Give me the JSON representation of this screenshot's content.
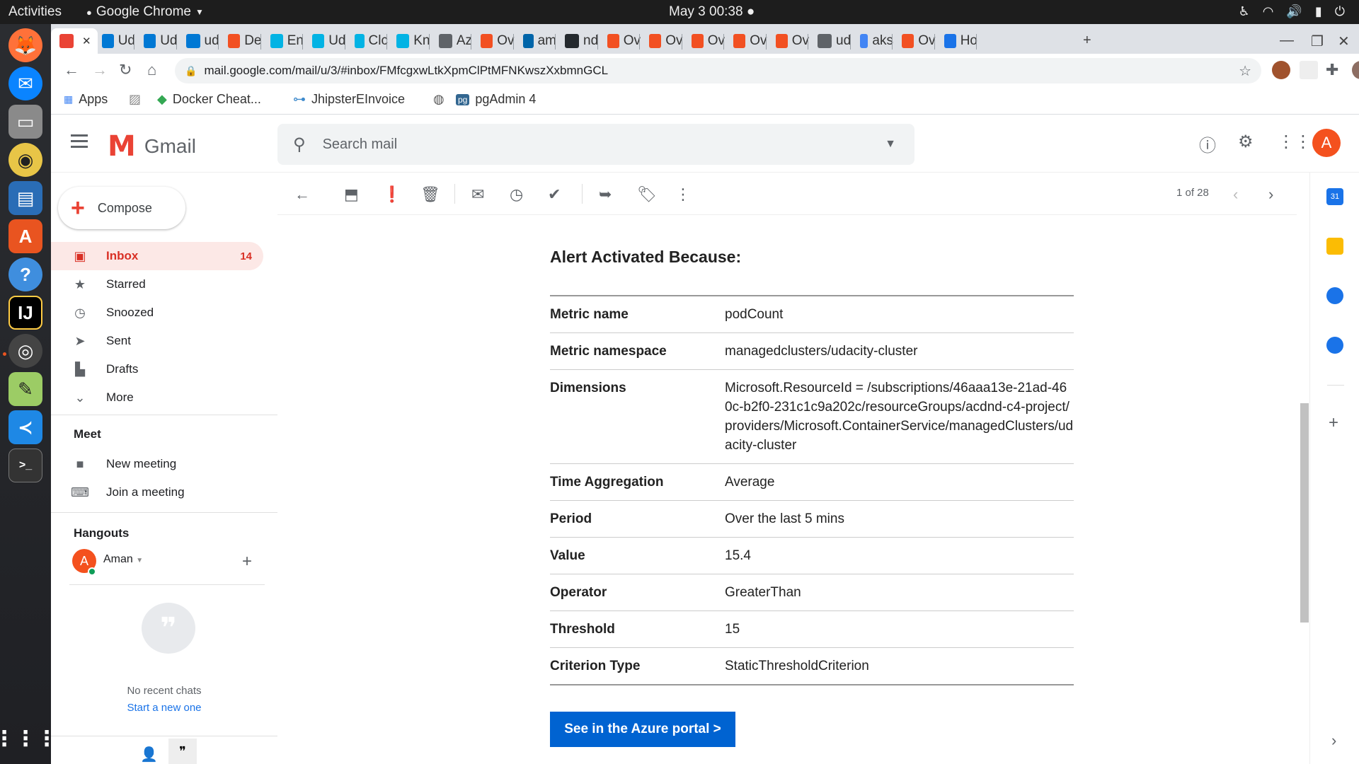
{
  "topbar": {
    "activities": "Activities",
    "app_name": "Google Chrome",
    "clock": "May 3  00:38"
  },
  "browser": {
    "tabs": [
      {
        "label": "",
        "icon": "gmail-icon"
      },
      {
        "label": "Ud",
        "icon": "azure-icon"
      },
      {
        "label": "Ud",
        "icon": "azure-icon"
      },
      {
        "label": "ud",
        "icon": "azure-icon"
      },
      {
        "label": "De",
        "icon": "microsoft-icon"
      },
      {
        "label": "En",
        "icon": "udacity-icon"
      },
      {
        "label": "Ud",
        "icon": "udacity-icon"
      },
      {
        "label": "Clc",
        "icon": "udacity-icon"
      },
      {
        "label": "Kn",
        "icon": "udacity-icon"
      },
      {
        "label": "Az",
        "icon": "globe-icon"
      },
      {
        "label": "Ov",
        "icon": "microsoft-icon"
      },
      {
        "label": "am",
        "icon": "vscode-icon"
      },
      {
        "label": "nd",
        "icon": "github-icon"
      },
      {
        "label": "Ov",
        "icon": "microsoft-icon"
      },
      {
        "label": "Ov",
        "icon": "microsoft-icon"
      },
      {
        "label": "Ov",
        "icon": "microsoft-icon"
      },
      {
        "label": "Ov",
        "icon": "microsoft-icon"
      },
      {
        "label": "Ov",
        "icon": "microsoft-icon"
      },
      {
        "label": "ud",
        "icon": "globe-icon"
      },
      {
        "label": "aks",
        "icon": "google-icon"
      },
      {
        "label": "Ov",
        "icon": "microsoft-icon"
      },
      {
        "label": "Ho",
        "icon": "help-icon"
      }
    ],
    "url": "mail.google.com/mail/u/3/#inbox/FMfcgxwLtkXpmClPtMFNKwszXxbmnGCL",
    "bookmarks": [
      "Apps",
      "Docker Cheat...",
      "JhipsterEInvoice",
      "",
      "pgAdmin 4"
    ]
  },
  "gmail": {
    "product_name": "Gmail",
    "search_placeholder": "Search mail",
    "avatar_letter": "A",
    "compose_label": "Compose",
    "nav": [
      {
        "label": "Inbox",
        "count": "14",
        "icon": "inbox-icon"
      },
      {
        "label": "Starred",
        "count": "",
        "icon": "star-icon"
      },
      {
        "label": "Snoozed",
        "count": "",
        "icon": "clock-icon"
      },
      {
        "label": "Sent",
        "count": "",
        "icon": "send-icon"
      },
      {
        "label": "Drafts",
        "count": "",
        "icon": "draft-icon"
      },
      {
        "label": "More",
        "count": "",
        "icon": "chevron-down-icon"
      }
    ],
    "meet": {
      "title": "Meet",
      "items": [
        "New meeting",
        "Join a meeting"
      ]
    },
    "hangouts": {
      "title": "Hangouts",
      "user": "Aman",
      "user_initial": "A",
      "no_chats": "No recent chats",
      "start_new": "Start a new one"
    },
    "pager": "1 of 28"
  },
  "email": {
    "heading": "Alert Activated Because:",
    "rows": [
      {
        "key": "Metric name",
        "value": "podCount"
      },
      {
        "key": "Metric namespace",
        "value": "managedclusters/udacity-cluster"
      },
      {
        "key": "Dimensions",
        "value": "Microsoft.ResourceId = /subscriptions/46aaa13e-21ad-460c-b2f0-231c1c9a202c/resourceGroups/acdnd-c4-project/providers/Microsoft.ContainerService/managedClusters/udacity-cluster"
      },
      {
        "key": "Time Aggregation",
        "value": "Average"
      },
      {
        "key": "Period",
        "value": "Over the last 5 mins"
      },
      {
        "key": "Value",
        "value": "15.4"
      },
      {
        "key": "Operator",
        "value": "GreaterThan"
      },
      {
        "key": "Threshold",
        "value": "15"
      },
      {
        "key": "Criterion Type",
        "value": "StaticThresholdCriterion"
      }
    ],
    "button": "See in the Azure portal >"
  },
  "colors": {
    "gmail_red": "#d93025",
    "azure_blue": "#0063d1",
    "avatar_orange": "#f4511e"
  }
}
